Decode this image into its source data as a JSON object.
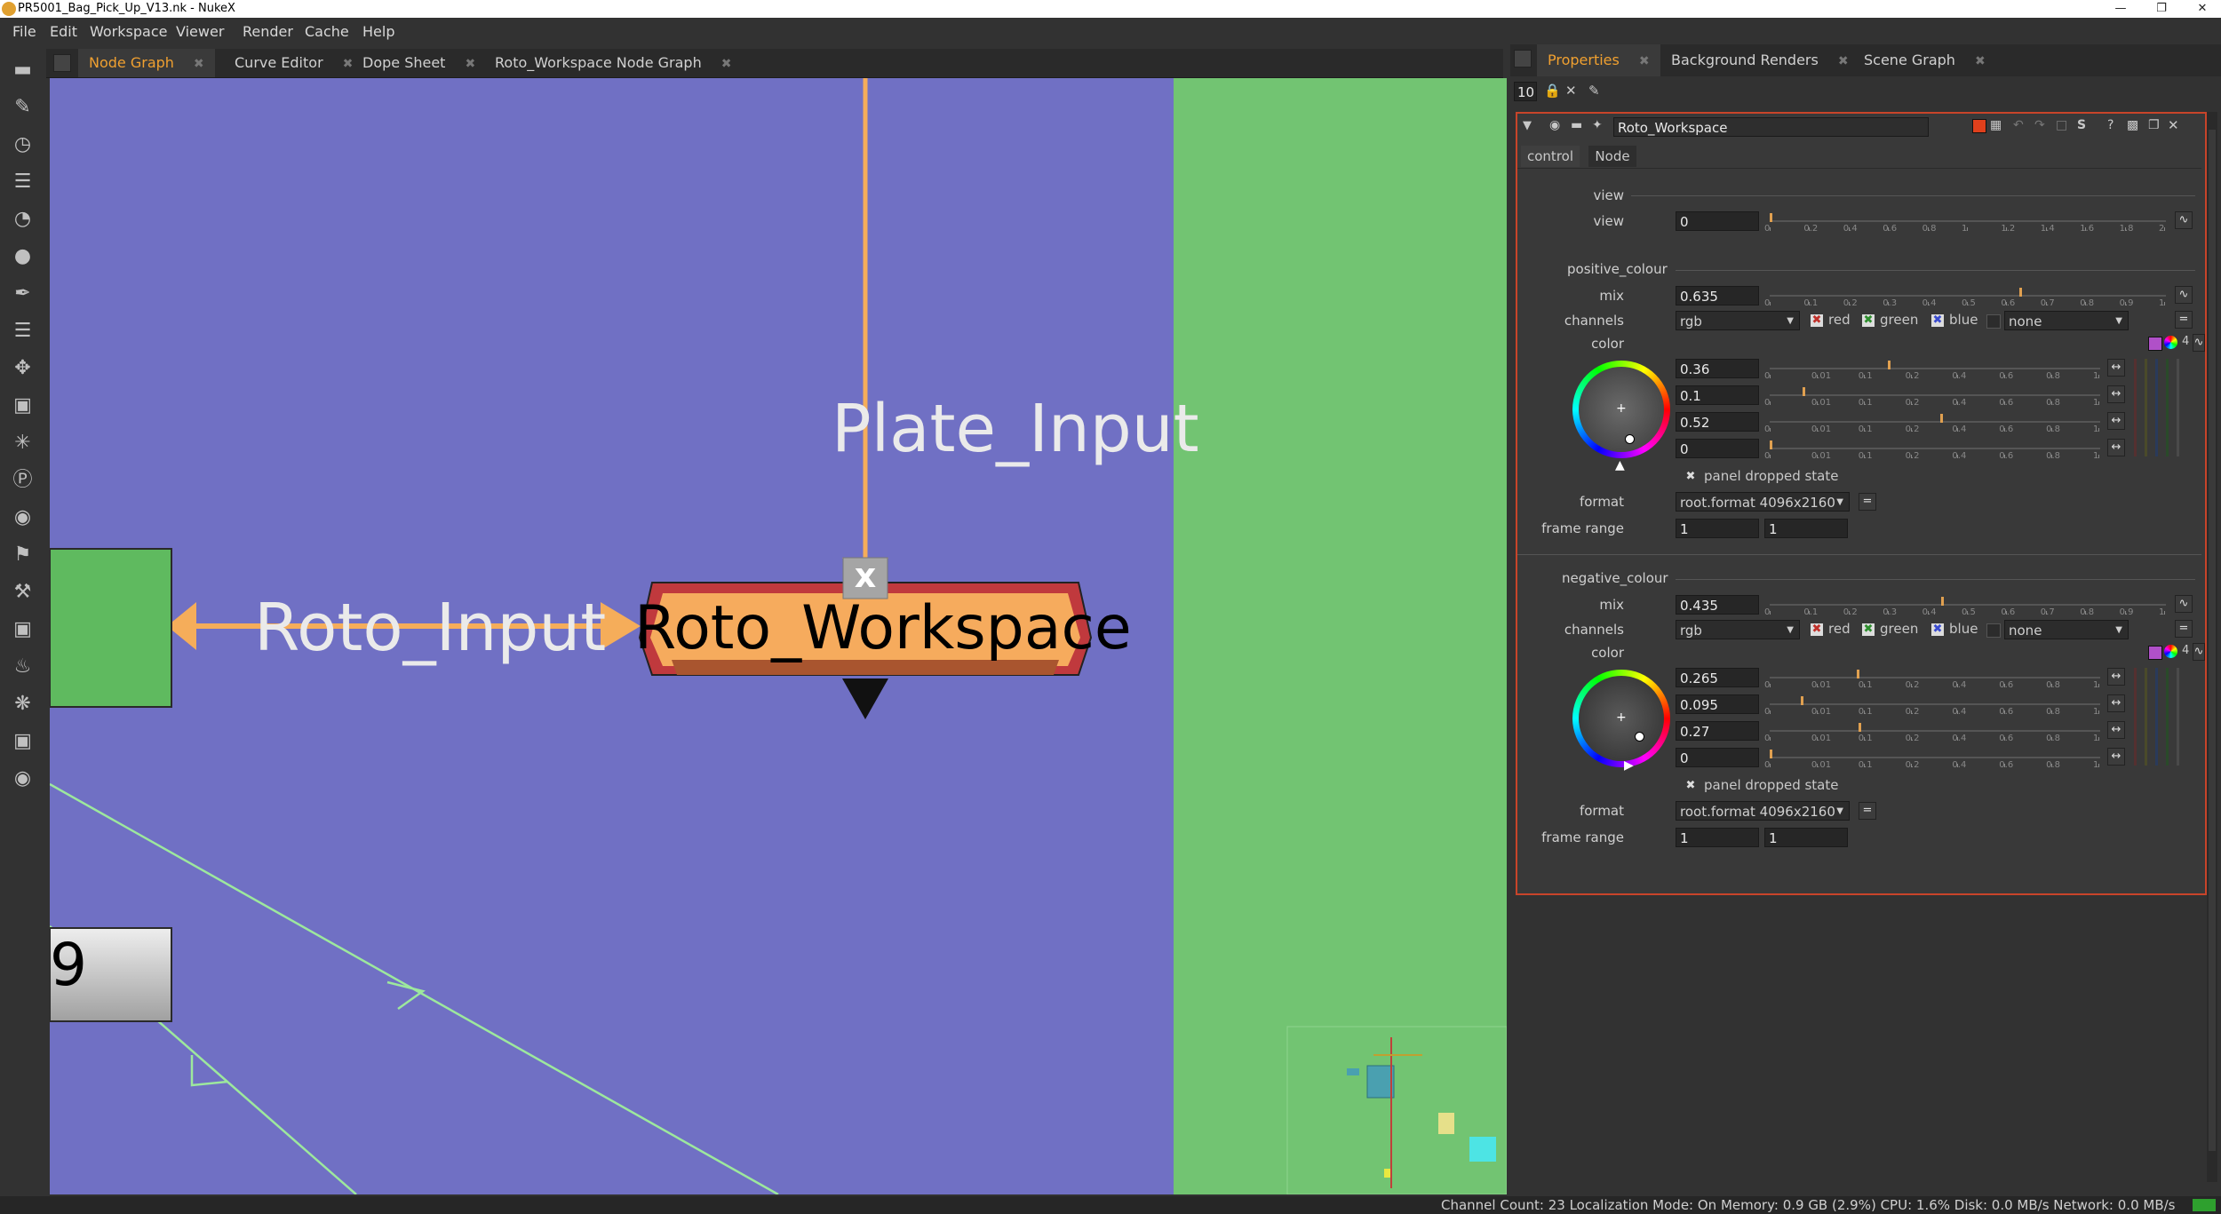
{
  "window": {
    "title": "PR5001_Bag_Pick_Up_V13.nk - NukeX"
  },
  "menu": [
    "File",
    "Edit",
    "Workspace",
    "Viewer",
    "Render",
    "Cache",
    "Help"
  ],
  "ng_tabs": [
    "Node Graph",
    "Curve Editor",
    "Dope Sheet",
    "Roto_Workspace Node Graph"
  ],
  "graph": {
    "plate_input": "Plate_Input",
    "roto_input": "Roto_Input",
    "node_name": "Roto_Workspace",
    "node_x": "x",
    "partial_node": "9"
  },
  "props_tabs": [
    "Properties",
    "Background Renders",
    "Scene Graph"
  ],
  "props": {
    "max_panels": "10",
    "node_name": "Roto_Workspace",
    "tabs": [
      "control",
      "Node"
    ],
    "view_section": "view",
    "view_label": "view",
    "view_value": "0",
    "view_ticks": [
      "0",
      "0.2",
      "0.4",
      "0.6",
      "0.8",
      "1",
      "1.2",
      "1.4",
      "1.6",
      "1.8",
      "2"
    ],
    "pos_section": "positive_colour",
    "mix_label": "mix",
    "pos_mix": "0.635",
    "mix_ticks": [
      "0",
      "0.1",
      "0.2",
      "0.3",
      "0.4",
      "0.5",
      "0.6",
      "0.7",
      "0.8",
      "0.9",
      "1"
    ],
    "channels_label": "channels",
    "channels_value": "rgb",
    "red": "red",
    "green": "green",
    "blue": "blue",
    "none": "none",
    "color_label": "color",
    "color_count": "4",
    "color_ticks": [
      "0",
      "0.01",
      "0.1",
      "0.2",
      "0.4",
      "0.6",
      "0.8",
      "1"
    ],
    "pos_color": [
      "0.36",
      "0.1",
      "0.52",
      "0"
    ],
    "dropped": "panel dropped state",
    "format_label": "format",
    "format_value": "root.format 4096x2160",
    "range_label": "frame range",
    "range_a": "1",
    "range_b": "1",
    "neg_section": "negative_colour",
    "neg_mix": "0.435",
    "neg_color": [
      "0.265",
      "0.095",
      "0.27",
      "0"
    ]
  },
  "status": "Channel Count: 23  Localization Mode: On  Memory: 0.9 GB (2.9%)  CPU: 1.6%  Disk: 0.0 MB/s  Network: 0.0 MB/s"
}
